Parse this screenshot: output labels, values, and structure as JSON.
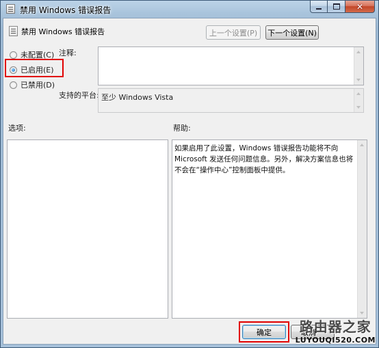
{
  "window": {
    "title": "禁用 Windows 错误报告",
    "close_glyph": "✕"
  },
  "header": {
    "title": "禁用 Windows 错误报告",
    "prev_setting": "上一个设置(P)",
    "next_setting": "下一个设置(N)"
  },
  "radios": [
    {
      "label": "未配置(C)",
      "checked": false
    },
    {
      "label": "已启用(E)",
      "checked": true
    },
    {
      "label": "已禁用(D)",
      "checked": false
    }
  ],
  "comment": {
    "label": "注释:",
    "value": ""
  },
  "platform": {
    "label": "支持的平台:",
    "value": "至少 Windows Vista"
  },
  "options": {
    "label": "选项:"
  },
  "help": {
    "label": "帮助:",
    "text": "如果启用了此设置，Windows 错误报告功能将不向 Microsoft 发送任何问题信息。另外，解决方案信息也将不会在“操作中心”控制面板中提供。"
  },
  "footer": {
    "ok": "确定",
    "cancel": "取消"
  },
  "watermark": {
    "title": "路由器之家",
    "url": "LUYOUQI520.COM"
  },
  "colors": {
    "highlight": "#e10000"
  }
}
